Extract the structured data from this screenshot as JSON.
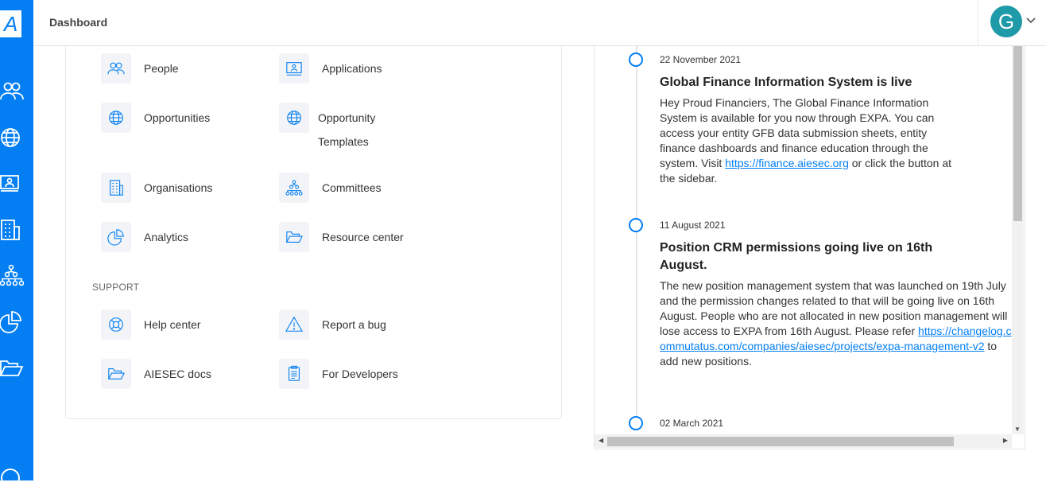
{
  "app": {
    "logo_letter": "A"
  },
  "header": {
    "title": "Dashboard",
    "avatar_letter": "G"
  },
  "rail": {
    "icons": [
      "people-icon",
      "globe-icon",
      "applications-icon",
      "organisations-icon",
      "committees-icon",
      "analytics-icon",
      "folder-icon",
      "help-icon"
    ]
  },
  "menu": {
    "people": "People",
    "applications": "Applications",
    "opportunities": "Opportunities",
    "opportunity_templates": "Opportunity Templates",
    "organisations": "Organisations",
    "committees": "Committees",
    "analytics": "Analytics",
    "resource_center": "Resource center",
    "support_heading": "SUPPORT",
    "help_center": "Help center",
    "report_bug": "Report a bug",
    "aiesec_docs": "AIESEC docs",
    "for_developers": "For Developers"
  },
  "news": {
    "items": [
      {
        "date": "22 November 2021",
        "title": "Global Finance Information System is live",
        "body_before": "Hey Proud Financiers, The Global Finance Information System is available for you now through EXPA. You can access your entity GFB data submission sheets, entity finance dashboards and finance education through the system. Visit ",
        "link": "https://finance.aiesec.org",
        "body_after": " or click the button at the sidebar."
      },
      {
        "date": "11 August 2021",
        "title": "Position CRM permissions going live on 16th August.",
        "body_before": "The new position management system that was launched on 19th July and the permission changes related to that will be going live on 16th August. People who are not allocated in new position management will lose access to EXPA from 16th August. Please refer ",
        "link": "https://changelog.commutatus.com/companies/aiesec/projects/expa-management-v2",
        "body_after": " to add new positions."
      },
      {
        "date": "02 March 2021"
      }
    ]
  },
  "colors": {
    "accent": "#037ef3",
    "avatar": "#1e9aa8"
  }
}
